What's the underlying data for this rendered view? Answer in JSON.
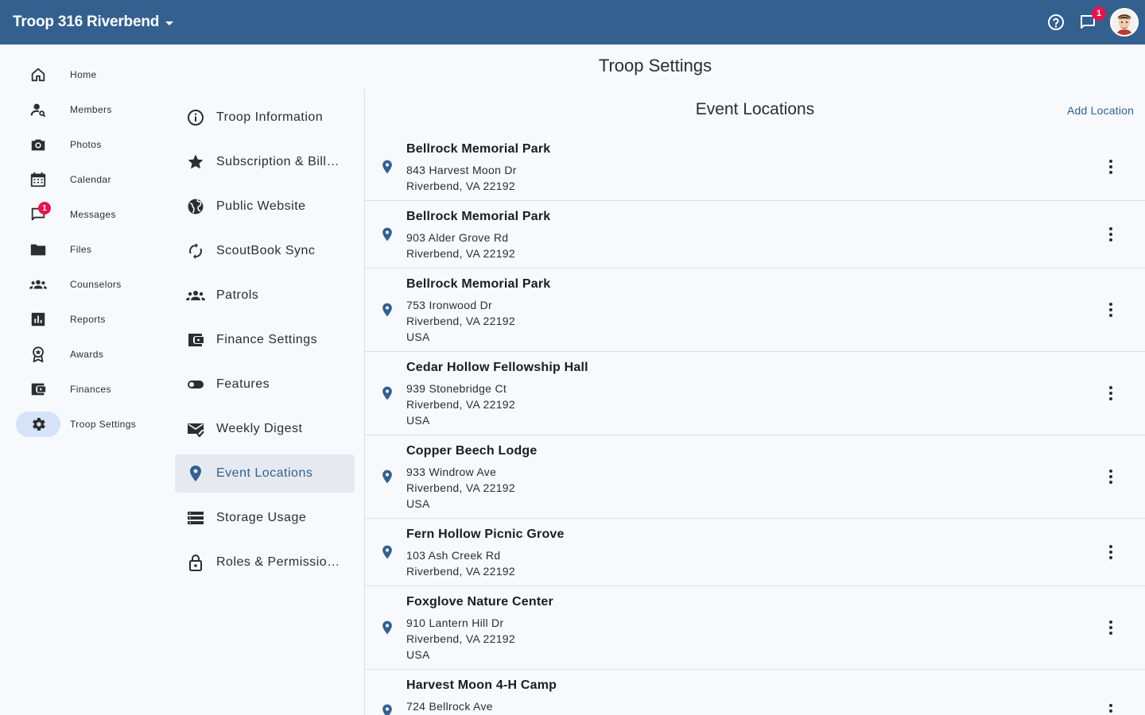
{
  "header": {
    "troop_name": "Troop 316 Riverbend",
    "message_badge": "1",
    "icons": [
      "help-circle-icon",
      "chat-icon",
      "avatar"
    ],
    "bar_color": "#33608f"
  },
  "nav": {
    "items": [
      {
        "label": "Home",
        "icon": "home-icon"
      },
      {
        "label": "Members",
        "icon": "person-search-icon"
      },
      {
        "label": "Photos",
        "icon": "camera-icon"
      },
      {
        "label": "Calendar",
        "icon": "calendar-icon"
      },
      {
        "label": "Messages",
        "icon": "chat-icon",
        "badge": "1"
      },
      {
        "label": "Files",
        "icon": "folder-icon"
      },
      {
        "label": "Counselors",
        "icon": "group-icon"
      },
      {
        "label": "Reports",
        "icon": "bar-chart-icon"
      },
      {
        "label": "Awards",
        "icon": "award-icon"
      },
      {
        "label": "Finances",
        "icon": "wallet-icon"
      },
      {
        "label": "Troop Settings",
        "icon": "gear-icon",
        "active": true
      }
    ]
  },
  "page": {
    "title": "Troop Settings"
  },
  "settings_menu": {
    "items": [
      {
        "label": "Troop Information",
        "icon": "info-icon"
      },
      {
        "label": "Subscription & Bill…",
        "icon": "star-icon"
      },
      {
        "label": "Public Website",
        "icon": "globe-icon"
      },
      {
        "label": "ScoutBook Sync",
        "icon": "sync-icon"
      },
      {
        "label": "Patrols",
        "icon": "group-icon"
      },
      {
        "label": "Finance Settings",
        "icon": "wallet-icon"
      },
      {
        "label": "Features",
        "icon": "toggle-icon"
      },
      {
        "label": "Weekly Digest",
        "icon": "mail-check-icon"
      },
      {
        "label": "Event Locations",
        "icon": "location-pin-icon",
        "active": true
      },
      {
        "label": "Storage Usage",
        "icon": "storage-icon"
      },
      {
        "label": "Roles & Permissio…",
        "icon": "lock-icon"
      }
    ]
  },
  "event_locations": {
    "title": "Event Locations",
    "add_label": "Add Location",
    "accent_color": "#33608f",
    "items": [
      {
        "name": "Bellrock Memorial Park",
        "lines": [
          "843 Harvest Moon Dr",
          "Riverbend, VA 22192"
        ]
      },
      {
        "name": "Bellrock Memorial Park",
        "lines": [
          "903 Alder Grove Rd",
          "Riverbend, VA 22192"
        ]
      },
      {
        "name": "Bellrock Memorial Park",
        "lines": [
          "753 Ironwood Dr",
          "Riverbend, VA 22192",
          "USA"
        ]
      },
      {
        "name": "Cedar Hollow Fellowship Hall",
        "lines": [
          "939 Stonebridge Ct",
          "Riverbend, VA 22192",
          "USA"
        ]
      },
      {
        "name": "Copper Beech Lodge",
        "lines": [
          "933 Windrow Ave",
          "Riverbend, VA 22192",
          "USA"
        ]
      },
      {
        "name": "Fern Hollow Picnic Grove",
        "lines": [
          "103 Ash Creek Rd",
          "Riverbend, VA 22192"
        ]
      },
      {
        "name": "Foxglove Nature Center",
        "lines": [
          "910 Lantern Hill Dr",
          "Riverbend, VA 22192",
          "USA"
        ]
      },
      {
        "name": "Harvest Moon 4-H Camp",
        "lines": [
          "724 Bellrock Ave"
        ]
      }
    ]
  }
}
